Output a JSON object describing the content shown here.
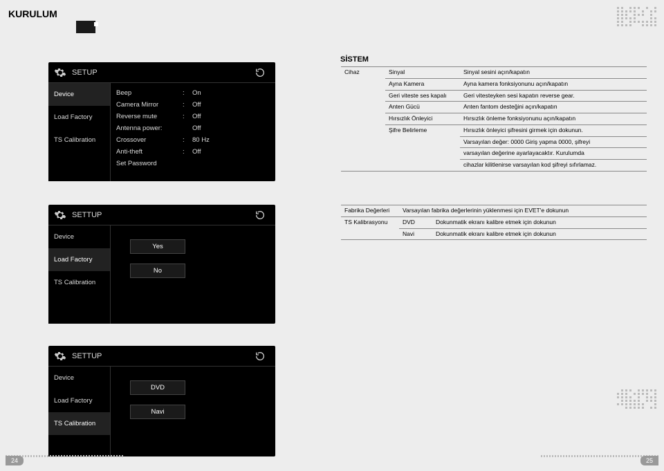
{
  "header": "KURULUM",
  "section_title": "SİSTEM",
  "panels": {
    "setup_title": "SETUP",
    "settup_title": "SETTUP",
    "sidebar": {
      "device": "Device",
      "load_factory": "Load Factory",
      "ts_calibration": "TS Calibration"
    },
    "settings": [
      {
        "label": "Beep",
        "value": "On"
      },
      {
        "label": "Camera Mirror",
        "value": "Off"
      },
      {
        "label": "Reverse mute",
        "value": "Off"
      },
      {
        "label": "Antenna power:",
        "value": "Off",
        "nocolon": true
      },
      {
        "label": "Crossover",
        "value": "80 Hz"
      },
      {
        "label": "Anti-theft",
        "value": "Off"
      },
      {
        "label": "Set Password",
        "value": "",
        "nocolon": true
      }
    ],
    "buttons": {
      "yes": "Yes",
      "no": "No",
      "dvd": "DVD",
      "navi": "Navi"
    }
  },
  "table1": {
    "rows": [
      {
        "c1": "Cihaz",
        "c2": "Sinyal",
        "c3": "Sinyal sesini açın/kapatın",
        "rs": 10
      },
      {
        "c2": "Ayna Kamera",
        "c3": "Ayna kamera fonksiyonunu açın/kapatın"
      },
      {
        "c2": "Geri viteste ses kapalı",
        "c3": "Geri vitesteyken sesi kapatın reverse gear."
      },
      {
        "c2": "Anten Gücü",
        "c3": "Anten fantom desteğini açın/kapatın"
      },
      {
        "c2": "Hırsızlık Önleyici",
        "c3": "Hırsızlık önleme fonksiyonunu açın/kapatın"
      },
      {
        "c2": "Şifre Belirleme",
        "c3": "Hırsızlık önleyici şifresini girmek için dokunun.",
        "rs2": 5
      },
      {
        "c3": "Varsayılan değer: 0000 Giriş yapma 0000, şifreyi"
      },
      {
        "c3": "varsayılan değerine ayarlayacaktır. Kurulumda"
      },
      {
        "c3": "cihazlar kilitlenirse varsayılan kod şifreyi sıfırlamaz."
      }
    ]
  },
  "table2": {
    "rows": [
      {
        "c1": "Fabrika Değerleri",
        "c23": "Varsayılan fabrika değerlerinin yüklenmesi için EVET'e dokunun"
      },
      {
        "c1": "TS Kalibrasyonu",
        "c2": "DVD",
        "c3": "Dokunmatik ekranı kalibre etmek için dokunun",
        "rs": 2
      },
      {
        "c2": "Navi",
        "c3": "Dokunmatik ekranı kalibre etmek için dokunun"
      }
    ]
  },
  "pages": {
    "left": "24",
    "right": "25"
  }
}
